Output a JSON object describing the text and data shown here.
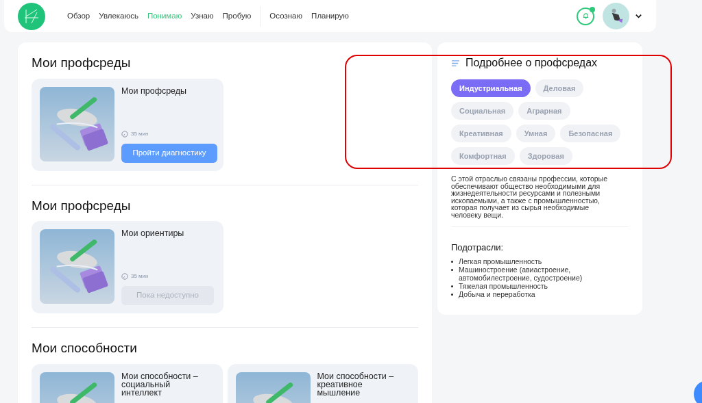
{
  "nav": [
    {
      "label": "Обзор",
      "selected": false
    },
    {
      "label": "Увлекаюсь",
      "selected": false
    },
    {
      "label": "Понимаю",
      "selected": true
    },
    {
      "label": "Узнаю",
      "selected": false
    },
    {
      "label": "Пробую",
      "selected": false
    },
    {
      "label": "Осознаю",
      "selected": false,
      "group_start": true
    },
    {
      "label": "Планирую",
      "selected": false
    }
  ],
  "notifications": {
    "unread": true
  },
  "sections": [
    {
      "title": "Мои профсреды",
      "cards": [
        {
          "title": "Мои профсреды",
          "duration": "35 мин",
          "button": {
            "label": "Пройти диагностику",
            "disabled": false
          }
        }
      ]
    },
    {
      "title": "Мои профсреды",
      "cards": [
        {
          "title": "Мои ориентиры",
          "duration": "35 мин",
          "button": {
            "label": "Пока недоступно",
            "disabled": true
          }
        }
      ]
    },
    {
      "title": "Мои способности",
      "cards": [
        {
          "title": "Мои способности – социальный интеллект"
        },
        {
          "title": "Мои способности – креативное мышление"
        }
      ]
    }
  ],
  "details": {
    "title": "Подробнее о профсредах",
    "tags": [
      [
        {
          "label": "Индустриальная",
          "selected": true
        },
        {
          "label": "Деловая",
          "selected": false
        }
      ],
      [
        {
          "label": "Социальная",
          "selected": false
        },
        {
          "label": "Аграрная",
          "selected": false
        }
      ],
      [
        {
          "label": "Креативная",
          "selected": false
        },
        {
          "label": "Умная",
          "selected": false
        },
        {
          "label": "Безопасная",
          "selected": false
        }
      ],
      [
        {
          "label": "Комфортная",
          "selected": false
        },
        {
          "label": "Здоровая",
          "selected": false
        }
      ]
    ],
    "description": "С этой отраслью связаны профессии, которые обеспечивают общество необходимыми для жизнедеятельности ресурсами и полезными ископаемыми, а также с промышленностью, которая получает из сырья необходимые человеку вещи.",
    "subtitle": "Подотрасли:",
    "items": [
      "Легкая промышленность",
      "Машиностроение (авиастроение, автомобилестроение, судостроение)",
      "Тяжелая промышленность",
      "Добыча и переработка"
    ]
  }
}
